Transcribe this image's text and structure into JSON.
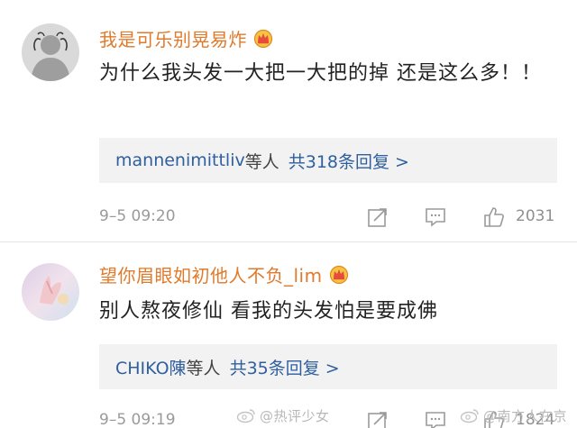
{
  "comments": [
    {
      "username": "我是可乐别晃易炸",
      "text": "为什么我头发一大把一大把的掉 还是这么多！！",
      "reply_users": "mannenimittliv",
      "reply_suffix": "等人",
      "reply_count": "共318条回复 >",
      "timestamp": "9–5 09:20",
      "like_count": "2031",
      "badge_icon": "crown-badge-icon",
      "avatar": "default-gray-avatar"
    },
    {
      "username": "望你眉眼如初他人不负_lim",
      "text": "别人熬夜修仙 看我的头发怕是要成佛",
      "reply_users": "CHIKO陳",
      "reply_suffix": "等人",
      "reply_count": "共35条回复 >",
      "timestamp": "9–5 09:19",
      "like_count": "1824",
      "badge_icon": "crown-badge-icon",
      "avatar": "pastel-hand-avatar"
    }
  ],
  "watermarks": [
    {
      "text": "@热评少女",
      "icon": "weibo-logo-icon"
    },
    {
      "text": "@南方人在京",
      "icon": "weibo-logo-icon"
    }
  ],
  "colors": {
    "username": "#e07a2c",
    "link": "#2f5f9e",
    "meta": "#9a9a9a",
    "reply_bg": "#f2f2f2"
  }
}
